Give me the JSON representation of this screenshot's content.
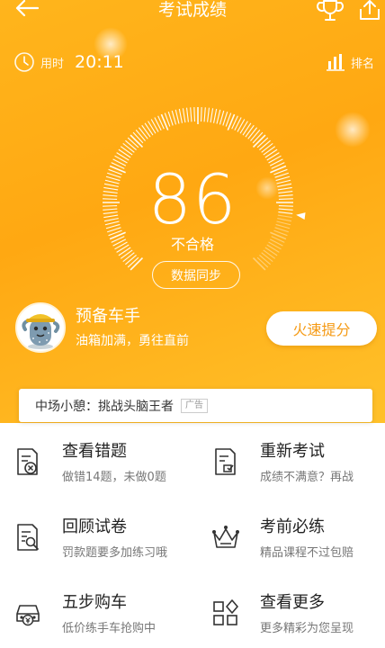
{
  "nav": {
    "title": "考试成绩"
  },
  "timer": {
    "label": "用时",
    "value": "20:11"
  },
  "rank": {
    "label": "排名"
  },
  "score": {
    "value": "86",
    "result": "不合格",
    "sync_label": "数据同步",
    "progress_percent": 86
  },
  "level": {
    "name": "预备车手",
    "motto": "油箱加满，勇往直前",
    "boost_label": "火速提分"
  },
  "ad": {
    "text": "中场小憩：挑战头脑王者",
    "tag": "广告"
  },
  "actions": [
    {
      "title": "查看错题",
      "subtitle": "做错14题，未做0题",
      "icon": "wrong-answers-icon"
    },
    {
      "title": "重新考试",
      "subtitle": "成绩不满意？再战",
      "icon": "retake-exam-icon"
    },
    {
      "title": "回顾试卷",
      "subtitle": "罚款题要多加练习哦",
      "icon": "review-paper-icon"
    },
    {
      "title": "考前必练",
      "subtitle": "精品课程不过包赔",
      "icon": "crown-icon"
    },
    {
      "title": "五步购车",
      "subtitle": "低价练手车抢购中",
      "icon": "car-purchase-icon"
    },
    {
      "title": "查看更多",
      "subtitle": "更多精彩为您呈现",
      "icon": "more-grid-icon"
    }
  ],
  "colors": {
    "hero": "#ffb51c",
    "accent_text": "#f59a14",
    "white": "#ffffff"
  }
}
